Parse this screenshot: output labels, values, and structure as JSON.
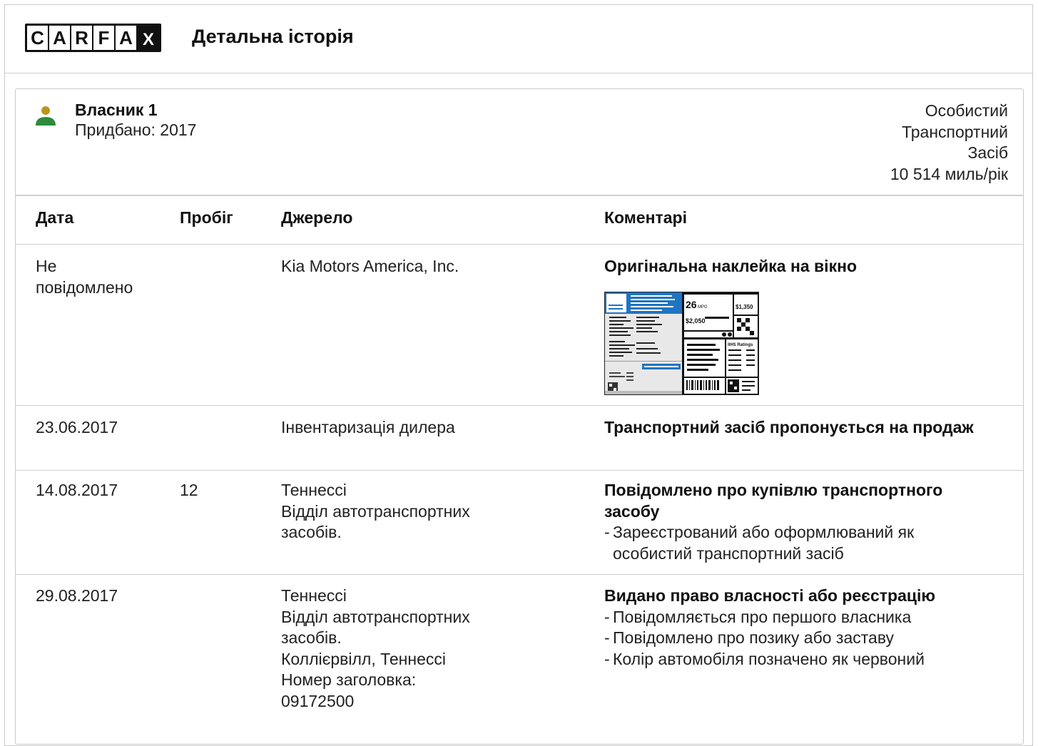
{
  "header": {
    "logo_letters": [
      "C",
      "A",
      "R",
      "F",
      "A",
      "X"
    ],
    "title": "Детальна історія"
  },
  "owner": {
    "name": "Власник 1",
    "bought": "Придбано: 2017",
    "type_lines": [
      "Особистий",
      "Транспортний",
      "Засіб",
      "10 514 миль/рік"
    ]
  },
  "table": {
    "headers": {
      "date": "Дата",
      "mileage": "Пробіг",
      "source": "Джерело",
      "comments": "Коментарі"
    },
    "rows": [
      {
        "date": [
          "Не",
          "повідомлено"
        ],
        "mileage": "",
        "source": [
          "Kia Motors America, Inc."
        ],
        "comment_title": "Оригінальна наклейка на вікно",
        "comment_items": [],
        "sticker": {
          "mpg": "26",
          "save": "$1,350",
          "cost": "$2,050",
          "ratings": "IIHS Ratings"
        }
      },
      {
        "date": [
          "23.06.2017"
        ],
        "mileage": "",
        "source": [
          "Інвентаризація дилера"
        ],
        "comment_title": "Транспортний засіб пропонується на продаж",
        "comment_items": []
      },
      {
        "date": [
          "14.08.2017"
        ],
        "mileage": "12",
        "source": [
          "Теннессі",
          "Відділ автотранспортних",
          "засобів."
        ],
        "comment_title": "Повідомлено про купівлю транспортного засобу",
        "comment_items": [
          "Зареєстрований або оформлюваний як особистий транспортний засіб"
        ]
      },
      {
        "date": [
          "29.08.2017"
        ],
        "mileage": "",
        "source": [
          "Теннессі",
          "Відділ автотранспортних",
          "засобів.",
          "Коллієрвілл, Теннессі",
          "Номер заголовка:",
          "09172500"
        ],
        "comment_title": "Видано право власності або реєстрацію",
        "comment_items": [
          "Повідомляється про першого власника",
          "Повідомлено про позику або заставу",
          "Колір автомобіля позначено як червоний"
        ]
      }
    ]
  },
  "colors": {
    "person_head": "#b8961e",
    "person_body": "#2e8b3e",
    "sticker_blue": "#1f74c2"
  }
}
